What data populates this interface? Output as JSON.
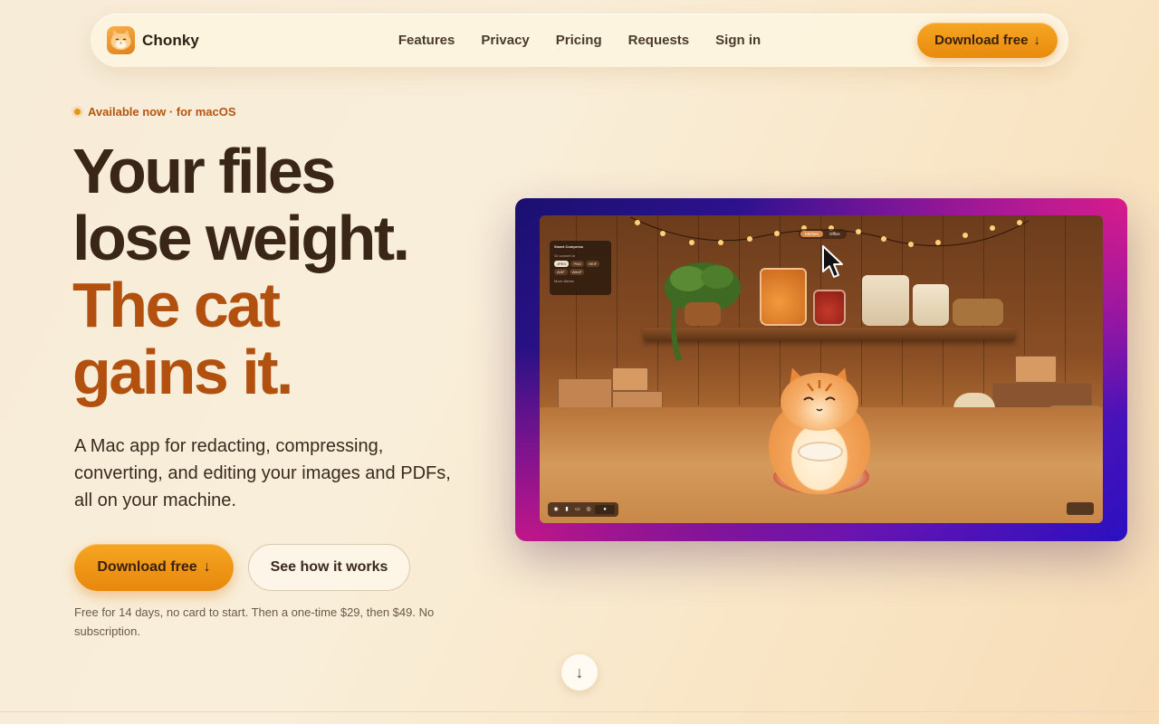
{
  "nav": {
    "brand": "Chonky",
    "links": [
      "Features",
      "Privacy",
      "Pricing",
      "Requests",
      "Sign in"
    ],
    "cta_label": "Download free",
    "cta_icon": "arrow-down-icon"
  },
  "hero": {
    "badge": "Available now · for macOS",
    "headline_line1": "Your files",
    "headline_line2": "lose weight.",
    "headline_line3": "The cat",
    "headline_line4": "gains it.",
    "subtext": "A Mac app for redacting, compressing, converting, and editing your images and PDFs, all on your machine.",
    "primary_button": "Download free",
    "secondary_button": "See how it works",
    "fineprint": "Free for 14 days, no card to start. Then a one-time $29, then $49. No subscription.",
    "scroll_icon": "arrow-down-icon"
  },
  "preview": {
    "segments": [
      "Kitchen",
      "Office"
    ],
    "panel_title": "Smart Compress",
    "panel_section": "Or convert to",
    "panel_formats": [
      "JPEG",
      "PNG",
      "HEIF",
      "AVIF",
      "WebP"
    ],
    "panel_more": "More dishes"
  },
  "colors": {
    "accent": "#e98a0d",
    "headline_dark": "#3a2617",
    "headline_accent": "#b2510f",
    "badge_text": "#b5540e"
  }
}
